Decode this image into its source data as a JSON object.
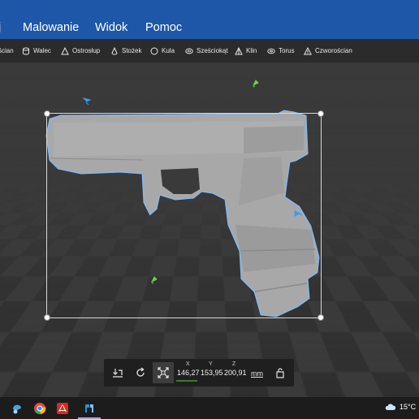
{
  "menu": {
    "items": [
      "j",
      "Malowanie",
      "Widok",
      "Pomoc"
    ]
  },
  "toolbar": {
    "tools": [
      {
        "label": "ścian",
        "icon": "wall-icon"
      },
      {
        "label": "Walec",
        "icon": "cylinder-icon"
      },
      {
        "label": "Ostrosłup",
        "icon": "pyramid-icon"
      },
      {
        "label": "Stożek",
        "icon": "cone-icon"
      },
      {
        "label": "Kula",
        "icon": "sphere-icon"
      },
      {
        "label": "Sześciokąt",
        "icon": "hexagon-icon"
      },
      {
        "label": "Klin",
        "icon": "wedge-icon"
      },
      {
        "label": "Torus",
        "icon": "torus-icon"
      },
      {
        "label": "Czworościan",
        "icon": "tetrahedron-icon"
      }
    ]
  },
  "panel": {
    "x_label": "X",
    "x_value": "146,27",
    "y_label": "Y",
    "y_value": "153,95",
    "z_label": "Z",
    "z_value": "200,91",
    "unit": "mm"
  },
  "taskbar": {
    "temperature": "15°C"
  },
  "colors": {
    "menubar": "#1f57a8",
    "selection_outline": "#8ec7ff",
    "axis_x": "#6fcf4a",
    "axis_y": "#3aa0e8"
  }
}
